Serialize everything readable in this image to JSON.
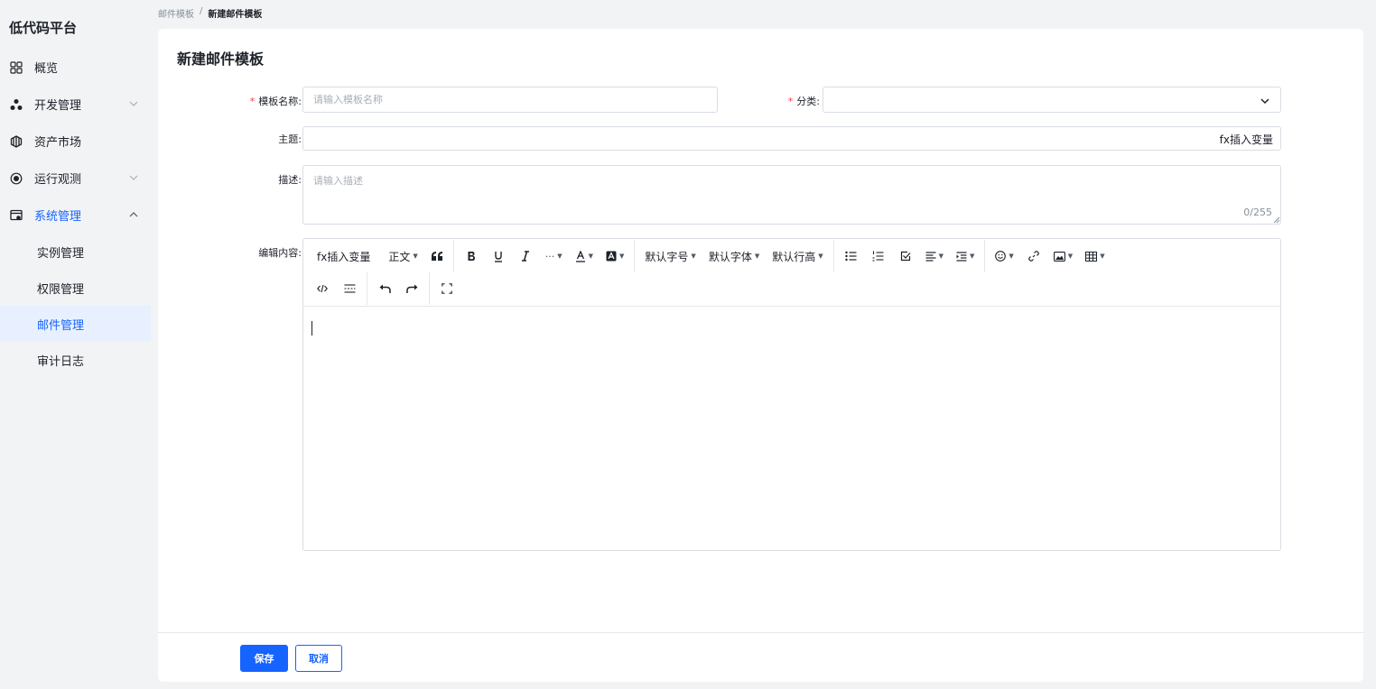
{
  "app": {
    "title": "低代码平台"
  },
  "sidebar": {
    "items": [
      {
        "label": "概览",
        "icon": "grid-icon"
      },
      {
        "label": "开发管理",
        "icon": "cluster-icon",
        "expandable": true
      },
      {
        "label": "资产市场",
        "icon": "cube-icon"
      },
      {
        "label": "运行观测",
        "icon": "radar-icon",
        "expandable": true
      },
      {
        "label": "系统管理",
        "icon": "settings-window-icon",
        "expandable": true,
        "expanded": true
      }
    ],
    "sub_items": [
      {
        "label": "实例管理"
      },
      {
        "label": "权限管理"
      },
      {
        "label": "邮件管理",
        "active": true
      },
      {
        "label": "审计日志"
      }
    ]
  },
  "breadcrumb": {
    "parent": "邮件模板",
    "separator": "/",
    "current": "新建邮件模板"
  },
  "page": {
    "title": "新建邮件模板"
  },
  "form": {
    "name_label": "模板名称:",
    "name_placeholder": "请输入模板名称",
    "category_label": "分类:",
    "subject_label": "主题:",
    "subject_insert_var": "fx插入变量",
    "desc_label": "描述:",
    "desc_placeholder": "请输入描述",
    "desc_counter": "0/255",
    "content_label": "编辑内容:",
    "required_mark": "*"
  },
  "editor": {
    "insert_var": "fx插入变量",
    "heading": "正文",
    "font_size": "默认字号",
    "font_family": "默认字体",
    "line_height": "默认行高"
  },
  "footer": {
    "save_label": "保存",
    "cancel_label": "取消"
  },
  "colors": {
    "accent": "#1664ff",
    "required": "#f53f3f",
    "active_bg": "#e8f0ff"
  }
}
